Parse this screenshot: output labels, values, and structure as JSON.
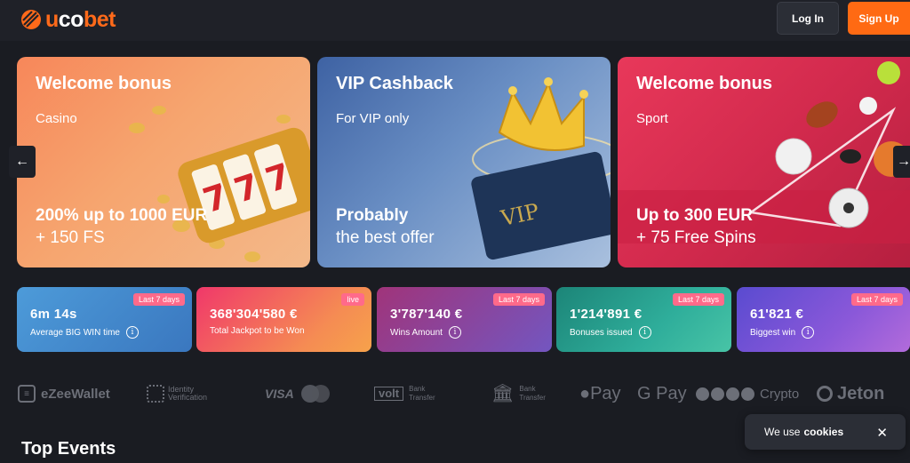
{
  "header": {
    "logo_u": "u",
    "logo_co": "co",
    "logo_bet": "bet",
    "login_label": "Log In",
    "signup_label": "Sign Up"
  },
  "banners": [
    {
      "title": "Welcome bonus",
      "subtitle": "Casino",
      "offer_line1": "200% up to 1000 EUR",
      "offer_line2": "+ 150 FS"
    },
    {
      "title": "VIP Cashback",
      "subtitle": "For VIP only",
      "offer_line1": "Probably",
      "offer_line2": "the best offer",
      "card_text": "VIP"
    },
    {
      "title": "Welcome bonus",
      "subtitle": "Sport",
      "offer_line1": "Up to 300 EUR",
      "offer_line2": "+ 75 Free Spins"
    }
  ],
  "carousel": {
    "prev_icon": "arrow-left-icon",
    "next_icon": "arrow-right-icon",
    "prev_glyph": "←",
    "next_glyph": "→"
  },
  "stats": [
    {
      "value": "6m 14s",
      "label": "Average BIG WIN time",
      "badge": "Last 7 days"
    },
    {
      "value": "368'304'580 €",
      "label": "Total Jackpot to be Won",
      "badge": "live"
    },
    {
      "value": "3'787'140 €",
      "label": "Wins Amount",
      "badge": "Last 7 days"
    },
    {
      "value": "1'214'891 €",
      "label": "Bonuses issued",
      "badge": "Last 7 days"
    },
    {
      "value": "61'821 €",
      "label": "Biggest win",
      "badge": "Last 7 days"
    }
  ],
  "payments": {
    "ezee": "eZeeWallet",
    "id_line1": "Identity",
    "id_line2": "Verification",
    "visa": "VISA",
    "volt": "volt",
    "volt_line1": "Bank",
    "volt_line2": "Transfer",
    "bank_line1": "Bank",
    "bank_line2": "Transfer",
    "apple": "Pay",
    "google": "G Pay",
    "crypto": "Crypto",
    "jeton": "Jeton"
  },
  "section_title": "Top Events",
  "cookie": {
    "text": "We use",
    "bold": "cookies",
    "close": "✕"
  },
  "colors": {
    "accent": "#ff6a13",
    "background": "#1a1c22",
    "header": "#1f2128"
  }
}
